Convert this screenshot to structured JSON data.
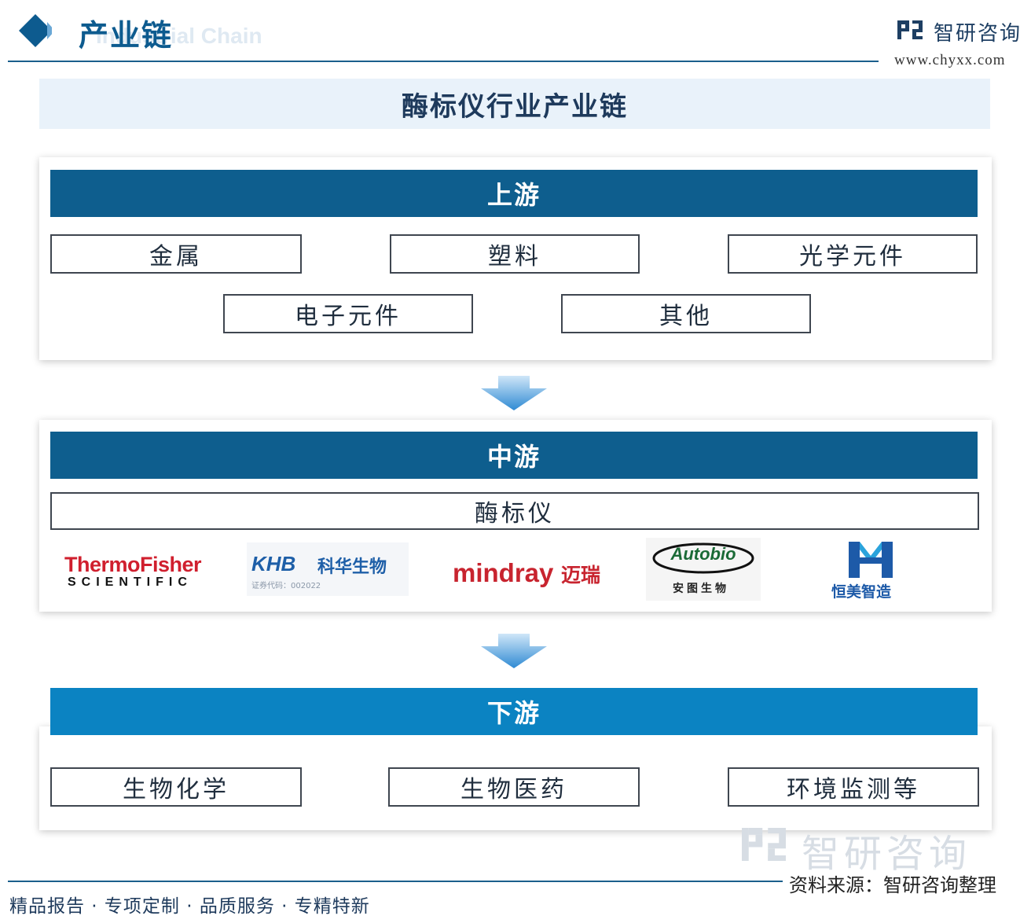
{
  "header": {
    "title": "产业链",
    "subtitle": "Industrial Chain",
    "brand_name": "智研咨询",
    "brand_url": "www.chyxx.com"
  },
  "diagram_title": "酶标仪行业产业链",
  "upstream": {
    "label": "上游",
    "items": [
      "金属",
      "塑料",
      "光学元件",
      "电子元件",
      "其他"
    ]
  },
  "midstream": {
    "label": "中游",
    "product": "酶标仪",
    "companies": {
      "thermofisher": {
        "name": "ThermoFisher",
        "sub": "SCIENTIFIC"
      },
      "kehua": {
        "name": "KHB",
        "cn": "科华生物",
        "code": "证券代码：002022"
      },
      "mindray": {
        "name": "mindray",
        "cn": "迈瑞"
      },
      "autobio": {
        "name": "Autobio",
        "cn": "安图生物"
      },
      "hengmei": {
        "cn": "恒美智造"
      }
    }
  },
  "downstream": {
    "label": "下游",
    "items": [
      "生物化学",
      "生物医药",
      "环境监测等"
    ]
  },
  "footer": {
    "watermark": "智研咨询",
    "source": "资料来源：智研咨询整理",
    "slogan": "精品报告 · 专项定制 · 品质服务 · 专精特新"
  },
  "colors": {
    "primary": "#0e5e8e",
    "downstream_bar": "#0b83c2",
    "arrow": "#3a92d6"
  }
}
